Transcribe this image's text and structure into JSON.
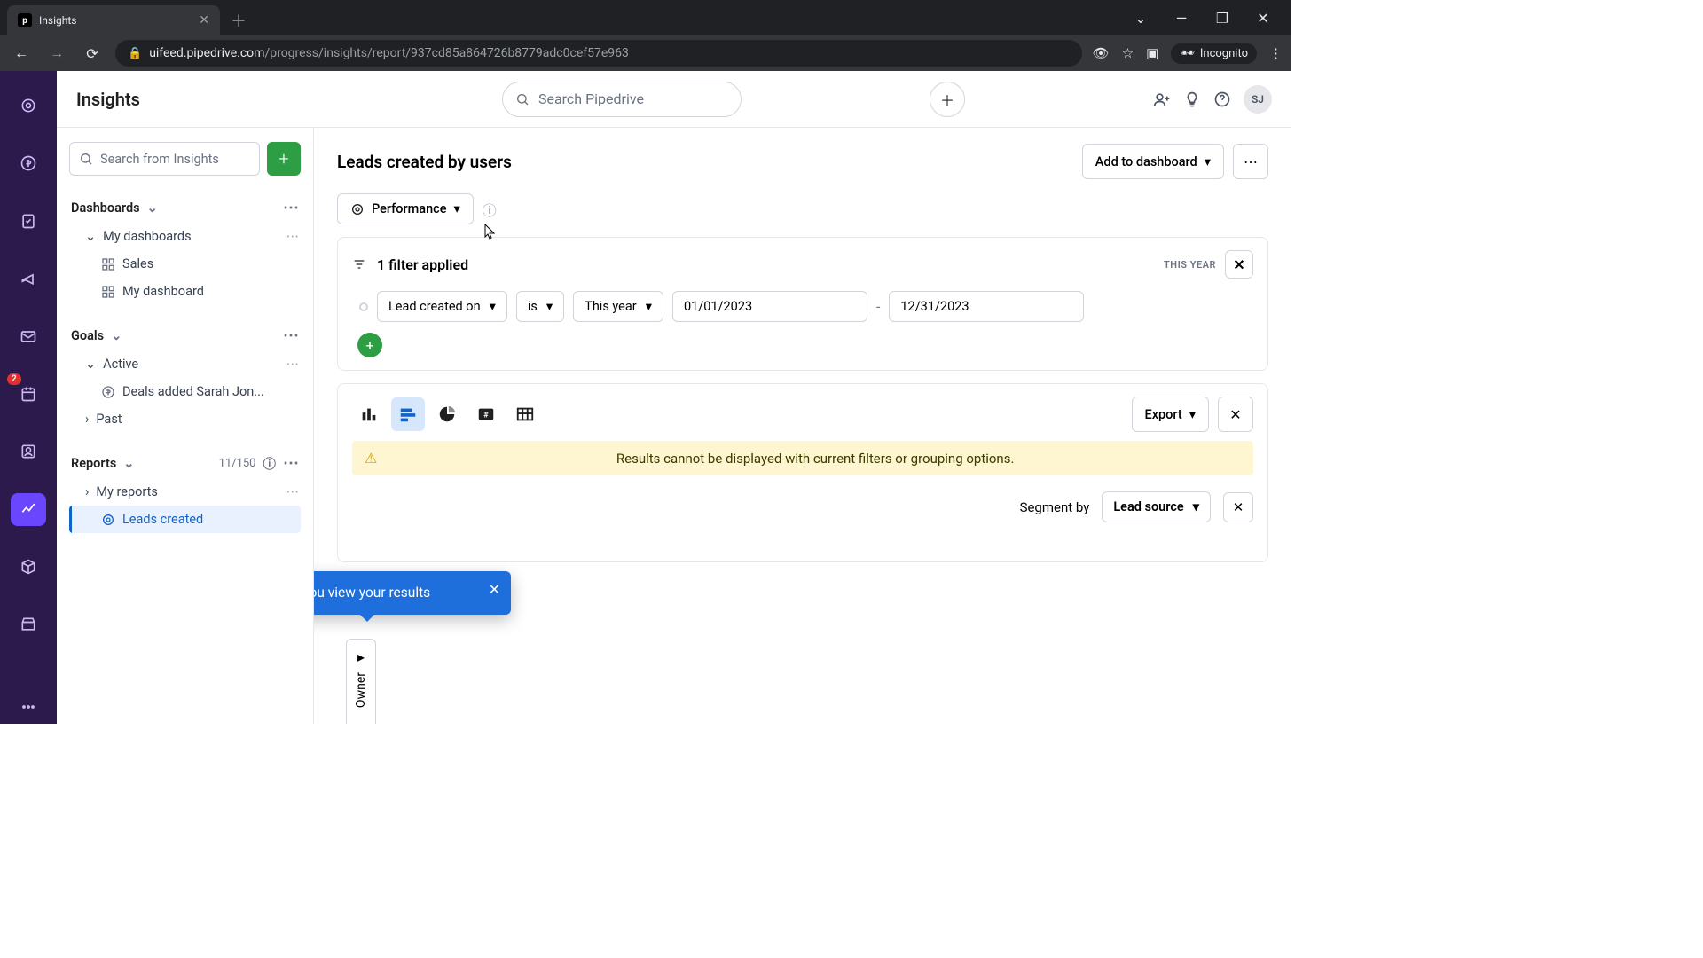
{
  "browser": {
    "tab_title": "Insights",
    "url_domain": "uifeed.pipedrive.com",
    "url_path": "/progress/insights/report/937cd85a864726b8779adc0cef57e963",
    "incognito": "Incognito"
  },
  "topbar": {
    "title": "Insights",
    "search_placeholder": "Search Pipedrive",
    "avatar": "SJ"
  },
  "rail": {
    "badge": "2"
  },
  "sidebar": {
    "search_placeholder": "Search from Insights",
    "dashboards": {
      "label": "Dashboards",
      "my_dashboards": "My dashboards",
      "items": [
        "Sales",
        "My dashboard"
      ]
    },
    "goals": {
      "label": "Goals",
      "active": "Active",
      "deal_item": "Deals added Sarah Jon...",
      "past": "Past"
    },
    "reports": {
      "label": "Reports",
      "count": "11/150",
      "my_reports": "My reports",
      "active_item": "Leads created"
    }
  },
  "page": {
    "title": "Leads created by users",
    "add_to_dashboard": "Add to dashboard",
    "performance": "Performance",
    "filter_applied": "1 filter applied",
    "this_year_pill": "THIS YEAR",
    "filter": {
      "field": "Lead created on",
      "op": "is",
      "range": "This year",
      "from": "01/01/2023",
      "to": "12/31/2023"
    },
    "export": "Export",
    "warning": "Results cannot be displayed with current filters or grouping options.",
    "segment_by": "Segment by",
    "segment_value": "Lead source",
    "tooltip": "Select how you view your results",
    "axis_label": "Owner"
  }
}
